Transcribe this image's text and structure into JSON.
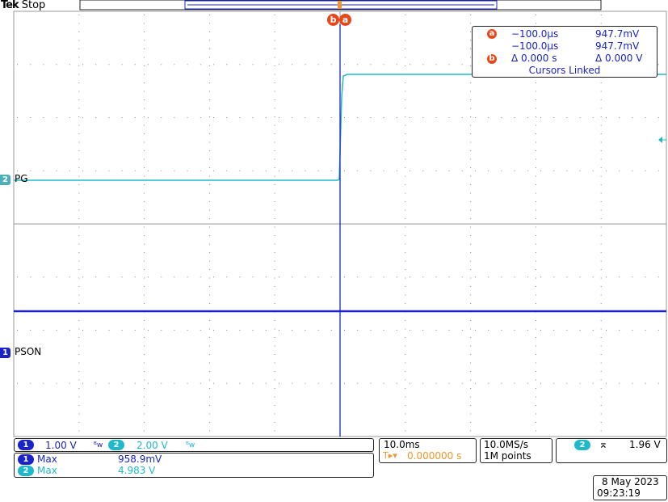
{
  "header": {
    "brand": "Tek",
    "status": "Stop"
  },
  "cursor_readout": {
    "a_time": "−100.0µs",
    "a_value": "947.7mV",
    "b_time": "−100.0µs",
    "b_value": "947.7mV",
    "delta_time": "Δ 0.000 s",
    "delta_value": "Δ 0.000 V",
    "linked": "Cursors Linked",
    "badge_a": "a",
    "badge_b": "b"
  },
  "cursor_tags": {
    "b": "b",
    "a": "a"
  },
  "channels": {
    "ch1": {
      "number": "1",
      "label": "PSON",
      "scale": "1.00 V",
      "color": "#1a23c8"
    },
    "ch2": {
      "number": "2",
      "label": "PG",
      "scale": "2.00 V",
      "color": "#1fb9c9"
    }
  },
  "measurements": {
    "m1_label": "Max",
    "m1_value": "958.9mV",
    "m2_label": "Max",
    "m2_value": "4.983 V"
  },
  "timebase": {
    "scale": "10.0ms",
    "position": "0.000000 s",
    "sample_rate": "10.0MS/s",
    "record": "1M points"
  },
  "trigger": {
    "channel": "2",
    "level": "1.96 V"
  },
  "datetime": {
    "date": "8 May 2023",
    "time": "09:23:19"
  },
  "colors": {
    "ch1": "#1a23c8",
    "ch2": "#1fb9c9",
    "cursor": "#e8471a",
    "trigger": "#f0962a",
    "grid": "#999999"
  },
  "icons": {
    "bandwidth": "bw-limit-icon",
    "trigger_edge": "rising-edge-icon"
  }
}
